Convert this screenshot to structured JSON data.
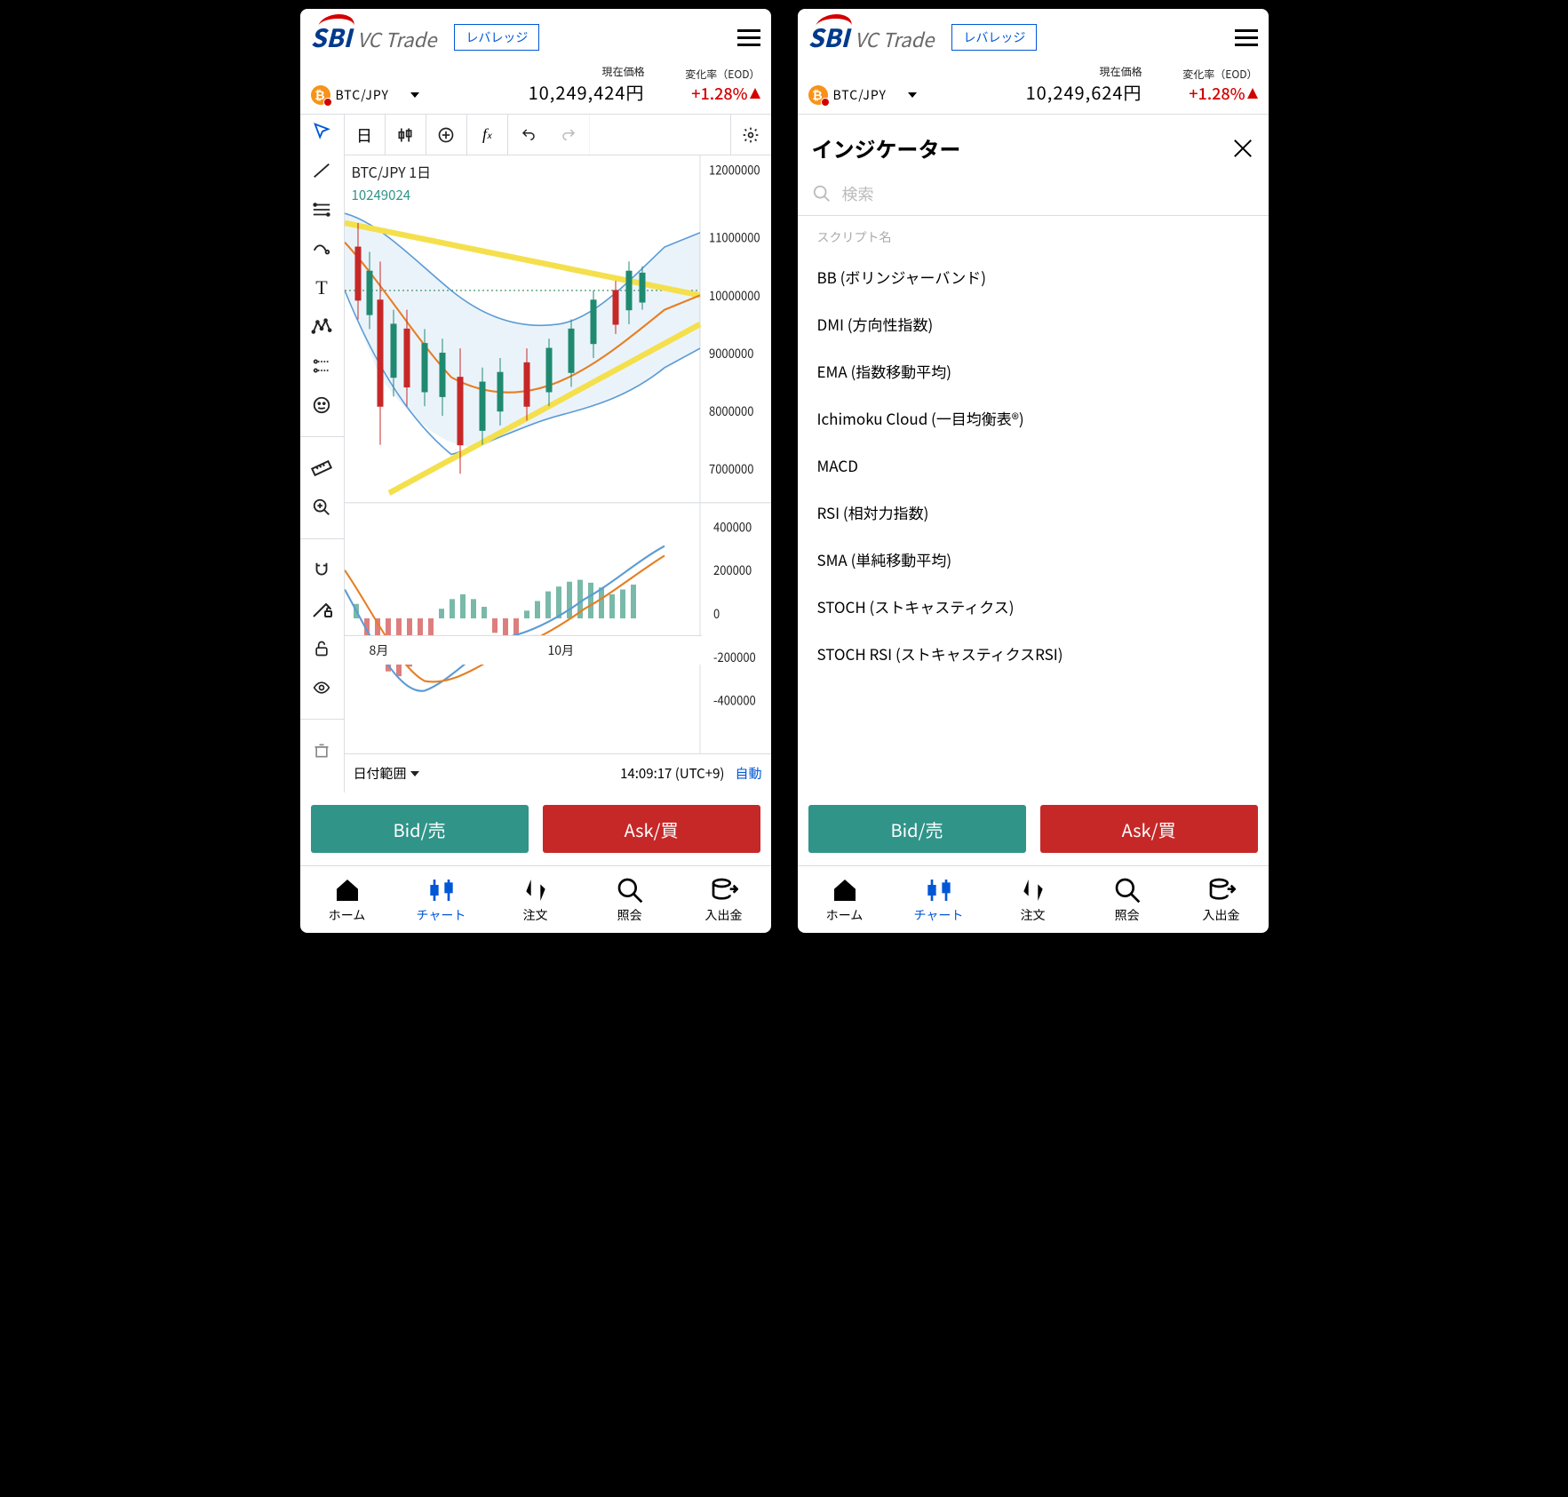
{
  "header": {
    "brand": "SBI",
    "subbrand": "VC Trade",
    "leverage_btn": "レバレッジ"
  },
  "pricebar": {
    "pair": "BTC/JPY",
    "price_label": "現在価格",
    "change_label": "変化率（EOD）",
    "change_value": "+1.28%"
  },
  "left": {
    "price_value": "10,249,424円",
    "chart_symbol": "BTC/JPY  1日",
    "chart_price": "10249024",
    "top_tools": {
      "tf": "日"
    },
    "months": [
      "8月",
      "10月"
    ],
    "date_range": "日付範囲",
    "clock": "14:09:17 (UTC+9)",
    "auto": "自動"
  },
  "right": {
    "price_value": "10,249,624円",
    "ind_title": "インジケーター",
    "search_placeholder": "検索",
    "script_label": "スクリプト名",
    "indicators": [
      "BB (ボリンジャーバンド)",
      "DMI (方向性指数)",
      "EMA (指数移動平均)",
      "Ichimoku Cloud (一目均衡表®)",
      "MACD",
      "RSI (相対力指数)",
      "SMA (単純移動平均)",
      "STOCH (ストキャスティクス)",
      "STOCH RSI (ストキャスティクスRSI)"
    ]
  },
  "bidask": {
    "bid": "Bid/売",
    "ask": "Ask/買"
  },
  "tabs": [
    "ホーム",
    "チャート",
    "注文",
    "照会",
    "入出金"
  ],
  "chart_data": {
    "type": "candlestick+indicator",
    "symbol": "BTC/JPY",
    "timeframe": "1D",
    "y_axis_main": [
      7000000,
      8000000,
      9000000,
      10000000,
      11000000,
      12000000
    ],
    "y_axis_sub": [
      -400000,
      -200000,
      0,
      200000,
      400000
    ],
    "x_ticks": [
      "8月",
      "10月"
    ],
    "last_price": 10249024,
    "trendlines": [
      {
        "type": "resistance",
        "from": [
          0,
          11200000
        ],
        "to": [
          100,
          10100000
        ],
        "color": "#f4e04d"
      },
      {
        "type": "support",
        "from": [
          20,
          7000000
        ],
        "to": [
          100,
          9600000
        ],
        "color": "#f4e04d"
      }
    ],
    "bollinger": {
      "upper_approx": [
        11200000,
        10000000,
        9100000,
        9400000,
        10600000,
        11000000
      ],
      "lower_approx": [
        10300000,
        8100000,
        7600000,
        7700000,
        8200000,
        9200000
      ]
    },
    "ma_fast_approx": [
      10800000,
      9300000,
      8500000,
      8700000,
      9400000,
      10200000
    ],
    "sub_indicator": {
      "name": "MACD-like",
      "series1_approx": [
        100000,
        -350000,
        -200000,
        0,
        120000,
        330000
      ],
      "series2_approx": [
        250000,
        -250000,
        -300000,
        -50000,
        80000,
        280000
      ],
      "hist_sign_approx": [
        "-",
        "-",
        "-",
        "+",
        "+",
        "+",
        "-",
        "-",
        "-",
        "-",
        "+",
        "+",
        "+",
        "+",
        "-",
        "+",
        "+",
        "+",
        "+",
        "+"
      ]
    }
  }
}
